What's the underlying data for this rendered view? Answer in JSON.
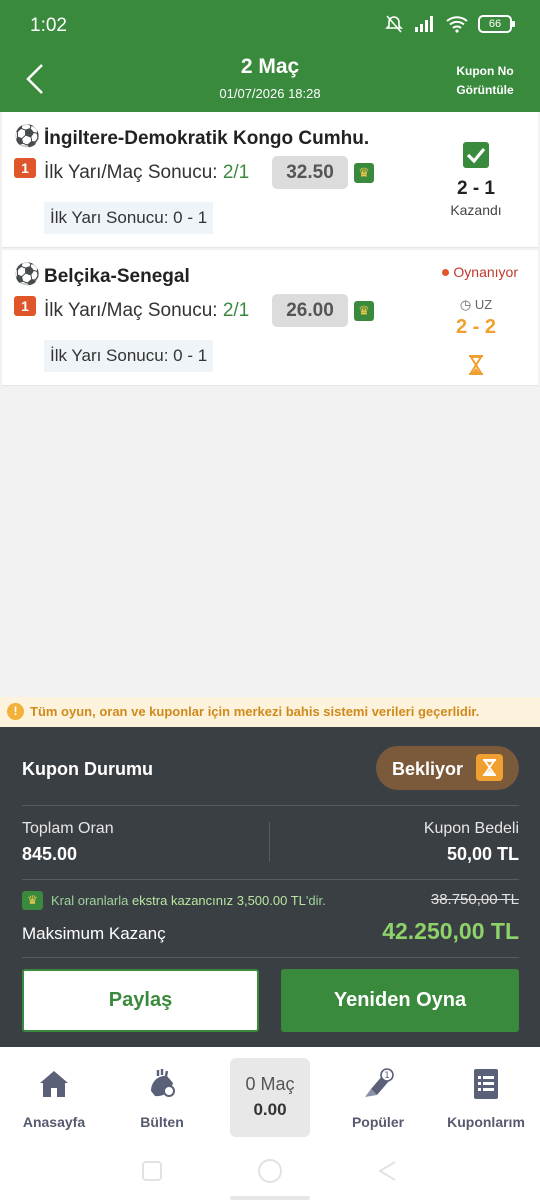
{
  "status_bar": {
    "time": "1:02",
    "battery": "66"
  },
  "header": {
    "title": "2 Maç",
    "date": "01/07/2026 18:28",
    "coupon_no_line1": "Kupon No",
    "coupon_no_line2": "Görüntüle"
  },
  "matches": [
    {
      "name": "İngiltere-Demokratik Kongo Cumhu.",
      "index": "1",
      "bet_label": "İlk Yarı/Maç Sonucu:",
      "selection": "2/1",
      "odd": "32.50",
      "half_time": "İlk Yarı Sonucu: 0 - 1",
      "score": "2 - 1",
      "result": "Kazandı"
    },
    {
      "name": "Belçika-Senegal",
      "index": "1",
      "bet_label": "İlk Yarı/Maç Sonucu:",
      "selection": "2/1",
      "odd": "26.00",
      "half_time": "İlk Yarı Sonucu: 0 - 1",
      "live": "Oynanıyor",
      "period": "UZ",
      "score": "2 - 2"
    }
  ],
  "warning": "Tüm oyun, oran ve kuponlar için merkezi bahis sistemi verileri geçerlidir.",
  "summary": {
    "title": "Kupon Durumu",
    "status": "Bekliyor",
    "total_odds_label": "Toplam Oran",
    "total_odds": "845.00",
    "stake_label": "Kupon Bedeli",
    "stake": "50,00 TL",
    "extra_prefix": "Kral oranlarla",
    "extra_strong": "ekstra kazancınız 3,500.00 TL",
    "extra_suffix": "'dir.",
    "old_max": "38.750,00 TL",
    "max_label": "Maksimum Kazanç",
    "max_value": "42.250,00 TL",
    "share": "Paylaş",
    "replay": "Yeniden Oyna"
  },
  "nav": {
    "home": "Anasayfa",
    "bulletin": "Bülten",
    "coupon_count": "0 Maç",
    "coupon_total": "0.00",
    "popular": "Popüler",
    "coupons": "Kuponlarım"
  },
  "colors": {
    "brand": "#3a8a3d",
    "panel": "#3a3f44",
    "accent": "#f0a030",
    "win": "#8ed26a"
  },
  "icons": [
    "soccer-ball-icon",
    "crown-icon",
    "check-icon",
    "hourglass-icon",
    "home-icon",
    "bulletin-icon",
    "popular-icon",
    "coupons-icon"
  ]
}
